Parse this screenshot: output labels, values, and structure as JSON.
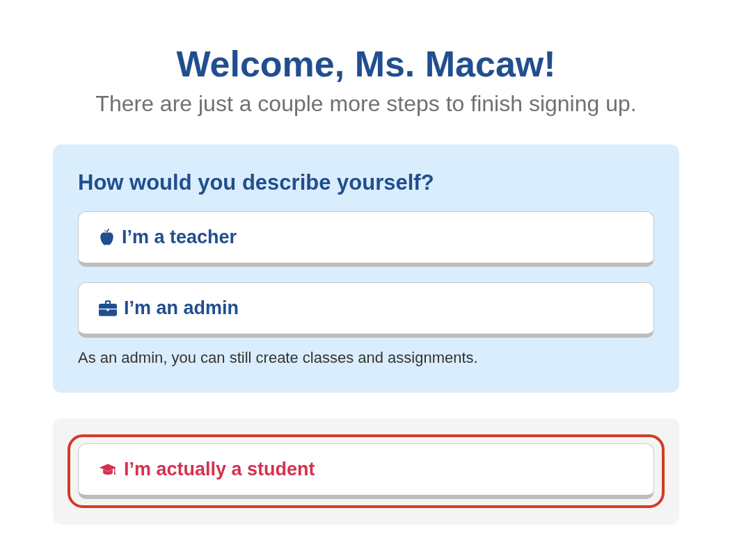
{
  "header": {
    "title": "Welcome, Ms. Macaw!",
    "subtitle": "There are just a couple more steps to finish signing up."
  },
  "role_panel": {
    "heading": "How would you describe yourself?",
    "options": [
      {
        "kind": "teacher",
        "label": "I’m a teacher",
        "focused": false
      },
      {
        "kind": "admin",
        "label": "I’m an admin",
        "focused": false
      }
    ],
    "note": "As an admin, you can still create classes and assignments."
  },
  "student_panel": {
    "options": [
      {
        "kind": "student",
        "label": "I’m actually a student",
        "focused": true
      }
    ]
  }
}
